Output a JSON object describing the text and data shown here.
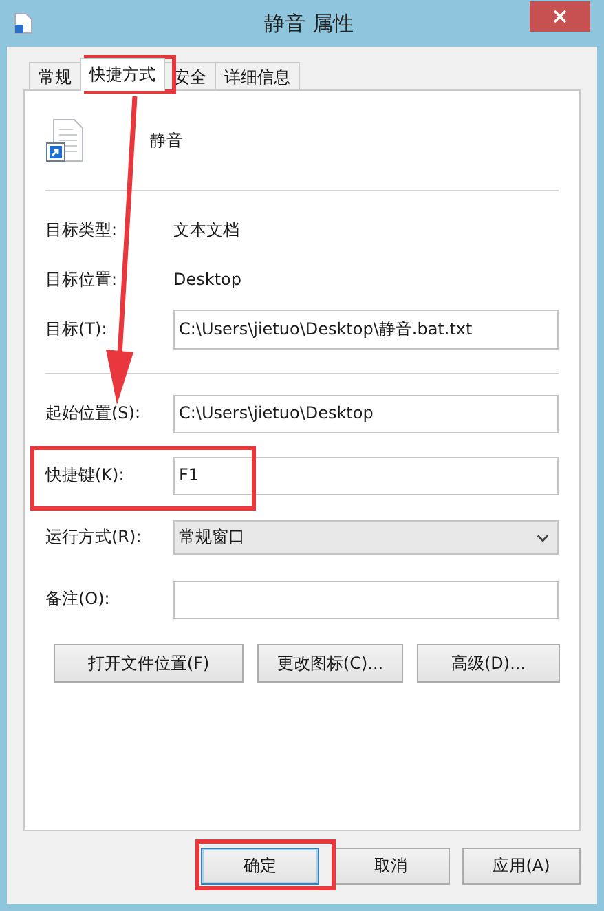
{
  "window": {
    "title": "静音 属性"
  },
  "tabs": [
    {
      "label": "常规",
      "selected": false
    },
    {
      "label": "快捷方式",
      "selected": true
    },
    {
      "label": "安全",
      "selected": false
    },
    {
      "label": "详细信息",
      "selected": false
    }
  ],
  "shortcut": {
    "name": "静音"
  },
  "info_rows": [
    {
      "label": "目标类型:",
      "value": "文本文档"
    },
    {
      "label": "目标位置:",
      "value": "Desktop"
    }
  ],
  "target": {
    "label": "目标(T):",
    "value": "C:\\Users\\jietuo\\Desktop\\静音.bat.txt"
  },
  "fields": [
    {
      "kind": "text",
      "label": "起始位置(S):",
      "value": "C:\\Users\\jietuo\\Desktop"
    },
    {
      "kind": "text",
      "label": "快捷键(K):",
      "value": "F1"
    },
    {
      "kind": "select",
      "label": "运行方式(R):",
      "value": "常规窗口"
    },
    {
      "kind": "text",
      "label": "备注(O):"
    }
  ],
  "action_buttons": [
    "打开文件位置(F)",
    "更改图标(C)...",
    "高级(D)..."
  ],
  "dialog_buttons": [
    {
      "label": "确定",
      "default": true
    },
    {
      "label": "取消",
      "default": false
    },
    {
      "label": "应用(A)",
      "default": false
    }
  ]
}
